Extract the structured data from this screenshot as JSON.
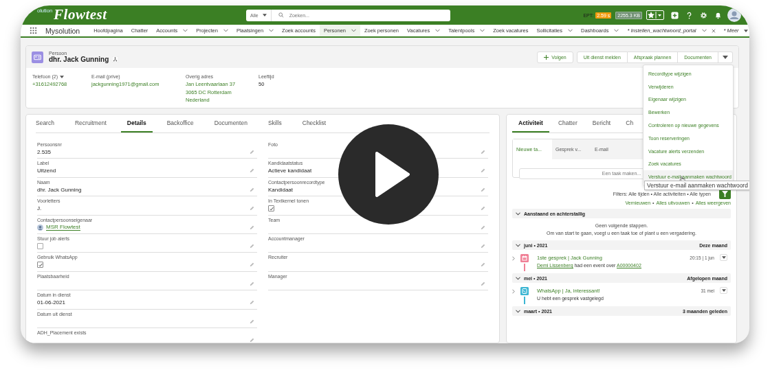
{
  "header": {
    "logo_prefix": "olution",
    "logo": "Flowtest",
    "search": {
      "scope": "Alle",
      "placeholder": "Zoeken..."
    },
    "ept_label": "EPT:",
    "ept_time": "2.59 s",
    "ept_size": "2255.3 KB"
  },
  "nav": {
    "app_name": "Mysolution",
    "items": [
      {
        "label": "Hoofdpagina",
        "menu": false,
        "selected": false
      },
      {
        "label": "Chatter",
        "menu": false,
        "selected": false
      },
      {
        "label": "Accounts",
        "menu": true,
        "selected": false
      },
      {
        "label": "Projecten",
        "menu": true,
        "selected": false
      },
      {
        "label": "Plaatsingen",
        "menu": true,
        "selected": false
      },
      {
        "label": "Zoek accounts",
        "menu": false,
        "selected": false
      },
      {
        "label": "Personen",
        "menu": true,
        "selected": true
      },
      {
        "label": "Zoek personen",
        "menu": false,
        "selected": false
      },
      {
        "label": "Vacatures",
        "menu": true,
        "selected": false
      },
      {
        "label": "Talentpools",
        "menu": true,
        "selected": false
      },
      {
        "label": "Zoek vacatures",
        "menu": false,
        "selected": false
      },
      {
        "label": "Sollicitaties",
        "menu": true,
        "selected": false
      },
      {
        "label": "Dashboards",
        "menu": true,
        "selected": false
      }
    ],
    "temp_tab": "* Instellen_wachtwoord_portal",
    "more": "* Meer"
  },
  "record": {
    "type": "Persoon",
    "name": "dhr. Jack Gunning",
    "actions": [
      {
        "kind": "follow",
        "label": "Volgen"
      },
      {
        "kind": "plain",
        "label": "Uit dienst melden"
      },
      {
        "kind": "plain",
        "label": "Afspraak plannen"
      },
      {
        "kind": "plain",
        "label": "Documenten"
      }
    ],
    "highlights": [
      {
        "label": "Telefoon (2)",
        "menu": true,
        "link": true,
        "values": [
          "+31612492768"
        ]
      },
      {
        "label": "E-mail (prive)",
        "menu": false,
        "link": true,
        "values": [
          "jackgunning1971@gmail.com"
        ]
      },
      {
        "label": "Overig adres",
        "menu": false,
        "link": true,
        "values": [
          "Jan Leentvaarlaan 37",
          "3065 DC Rotterdam",
          "Nederland"
        ]
      },
      {
        "label": "Leeftijd",
        "menu": false,
        "link": false,
        "values": [
          "50"
        ]
      }
    ]
  },
  "actions_menu": {
    "items": [
      {
        "label": "Recordtype wijzigen",
        "selected": false
      },
      {
        "label": "Verwijderen",
        "selected": false
      },
      {
        "label": "Eigenaar wijzigen",
        "selected": false
      },
      {
        "label": "Bewerken",
        "selected": false
      },
      {
        "label": "Controleren op nieuwe gegevens",
        "selected": false
      },
      {
        "label": "Toon reserveringen",
        "selected": false
      },
      {
        "label": "Vacature alerts verzenden",
        "selected": false
      },
      {
        "label": "Zoek vacatures",
        "selected": false
      },
      {
        "label": "Verstuur e-mail aanmaken wachtwoord",
        "selected": true
      }
    ],
    "tooltip": "Verstuur e-mail aanmaken wachtwoord"
  },
  "details": {
    "tabs": [
      {
        "label": "Search",
        "selected": false
      },
      {
        "label": "Recruitment",
        "selected": false
      },
      {
        "label": "Details",
        "selected": true
      },
      {
        "label": "Backoffice",
        "selected": false
      },
      {
        "label": "Documenten",
        "selected": false
      },
      {
        "label": "Skills",
        "selected": false
      },
      {
        "label": "Checklist",
        "selected": false
      }
    ],
    "columns": [
      [
        {
          "kind": "text",
          "label": "Persoonsnr",
          "value": "2.535"
        },
        {
          "kind": "text",
          "label": "Label",
          "value": "Uitzend"
        },
        {
          "kind": "text",
          "label": "Naam",
          "value": "dhr. Jack Gunning"
        },
        {
          "kind": "text",
          "label": "Voorletters",
          "value": "J."
        },
        {
          "kind": "user",
          "label": "Contactpersoonseigenaar",
          "value": "MSR Flowtest"
        },
        {
          "kind": "checkbox",
          "label": "Stuur job alerts",
          "checked": false
        },
        {
          "kind": "checkbox",
          "label": "Gebruik WhatsApp",
          "checked": true
        },
        {
          "kind": "text",
          "label": "Plaatsbaarheid"
        },
        {
          "kind": "text",
          "label": "Datum in dienst",
          "value": "01-06-2021"
        },
        {
          "kind": "text",
          "label": "Datum uit dienst"
        },
        {
          "kind": "text",
          "label": "ADH_Placement exists"
        }
      ],
      [
        {
          "kind": "text",
          "label": "Foto"
        },
        {
          "kind": "text",
          "label": "Kandidaatstatus",
          "value": "Actieve kandidaat"
        },
        {
          "kind": "text",
          "label": "Contactpersoonrecordtype",
          "value": "Kandidaat"
        },
        {
          "kind": "checkbox",
          "label": "In Textkernel tonen",
          "checked": true
        },
        {
          "kind": "text",
          "label": "Team"
        },
        {
          "kind": "text",
          "label": "Accountmanager"
        },
        {
          "kind": "text",
          "label": "Recruiter"
        },
        {
          "kind": "text",
          "label": "Manager"
        }
      ]
    ]
  },
  "activity": {
    "tabs": [
      {
        "label": "Activiteit",
        "selected": true
      },
      {
        "label": "Chatter",
        "selected": false
      },
      {
        "label": "Bericht",
        "selected": false
      },
      {
        "label": "Ch",
        "selected": false
      }
    ],
    "composer_tabs": [
      {
        "label": "Nieuwe ta...",
        "selected": true
      },
      {
        "label": "Gesprek v...",
        "selected": false
      },
      {
        "label": "E-mail",
        "selected": false
      }
    ],
    "composer_placeholder": "Een taak maken...",
    "filters": "Filters: Alle tijden • Alle activiteiten • Alle typen",
    "links": [
      "Vernieuwen",
      "Alles uitvouwen",
      "Alles weergeven"
    ],
    "link_separator": "•",
    "sections": [
      {
        "title": "Aanstaand en achterstallig",
        "empty": [
          "Geen volgende stappen.",
          "Om van start te gaan, voegt u een taak toe of plant u een vergadering."
        ]
      },
      {
        "title": "juni • 2021",
        "period": "Deze maand",
        "items": [
          {
            "kind": "event",
            "color": "#f08096",
            "title": "1ste gesprek | Jack Gunning",
            "time": "20:15 | 1 jun",
            "actor": "Demi Lissenberg",
            "text": "had een event over",
            "subject": "A00000402"
          }
        ]
      },
      {
        "title": "mei • 2021",
        "period": "Afgelopen maand",
        "items": [
          {
            "kind": "whatsapp",
            "color": "#3cb6d3",
            "title": "WhatsApp | Ja, interessant!",
            "time": "31 mei",
            "text": "U hebt een gesprek vastgelegd"
          }
        ]
      },
      {
        "title": "maart • 2021",
        "period": "3 maanden geleden"
      }
    ]
  }
}
